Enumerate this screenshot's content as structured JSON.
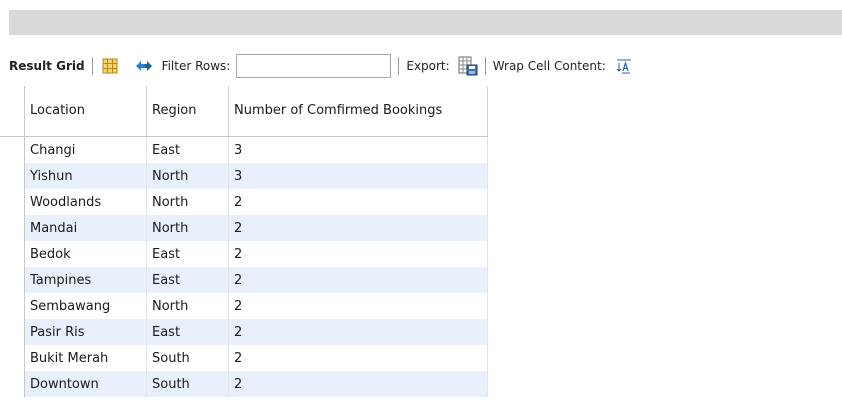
{
  "toolbar": {
    "result_grid_label": "Result Grid",
    "filter_label": "Filter Rows:",
    "filter_value": "",
    "export_label": "Export:",
    "wrap_label": "Wrap Cell Content:"
  },
  "grid": {
    "columns": [
      "Location",
      "Region",
      "Number of Comfirmed Bookings"
    ],
    "rows": [
      [
        "Changi",
        "East",
        "3"
      ],
      [
        "Yishun",
        "North",
        "3"
      ],
      [
        "Woodlands",
        "North",
        "2"
      ],
      [
        "Mandai",
        "North",
        "2"
      ],
      [
        "Bedok",
        "East",
        "2"
      ],
      [
        "Tampines",
        "East",
        "2"
      ],
      [
        "Sembawang",
        "North",
        "2"
      ],
      [
        "Pasir Ris",
        "East",
        "2"
      ],
      [
        "Bukit Merah",
        "South",
        "2"
      ],
      [
        "Downtown",
        "South",
        "2"
      ]
    ]
  },
  "icons": {
    "grid_toggle": "grid-layout-icon",
    "refresh": "refresh-arrows-icon",
    "export": "save-export-icon",
    "wrap": "wrap-text-icon"
  },
  "colors": {
    "alt_row": "#e8f0fb",
    "header_bar": "#d9d9d9",
    "refresh_icon": "#2a7fc8"
  }
}
